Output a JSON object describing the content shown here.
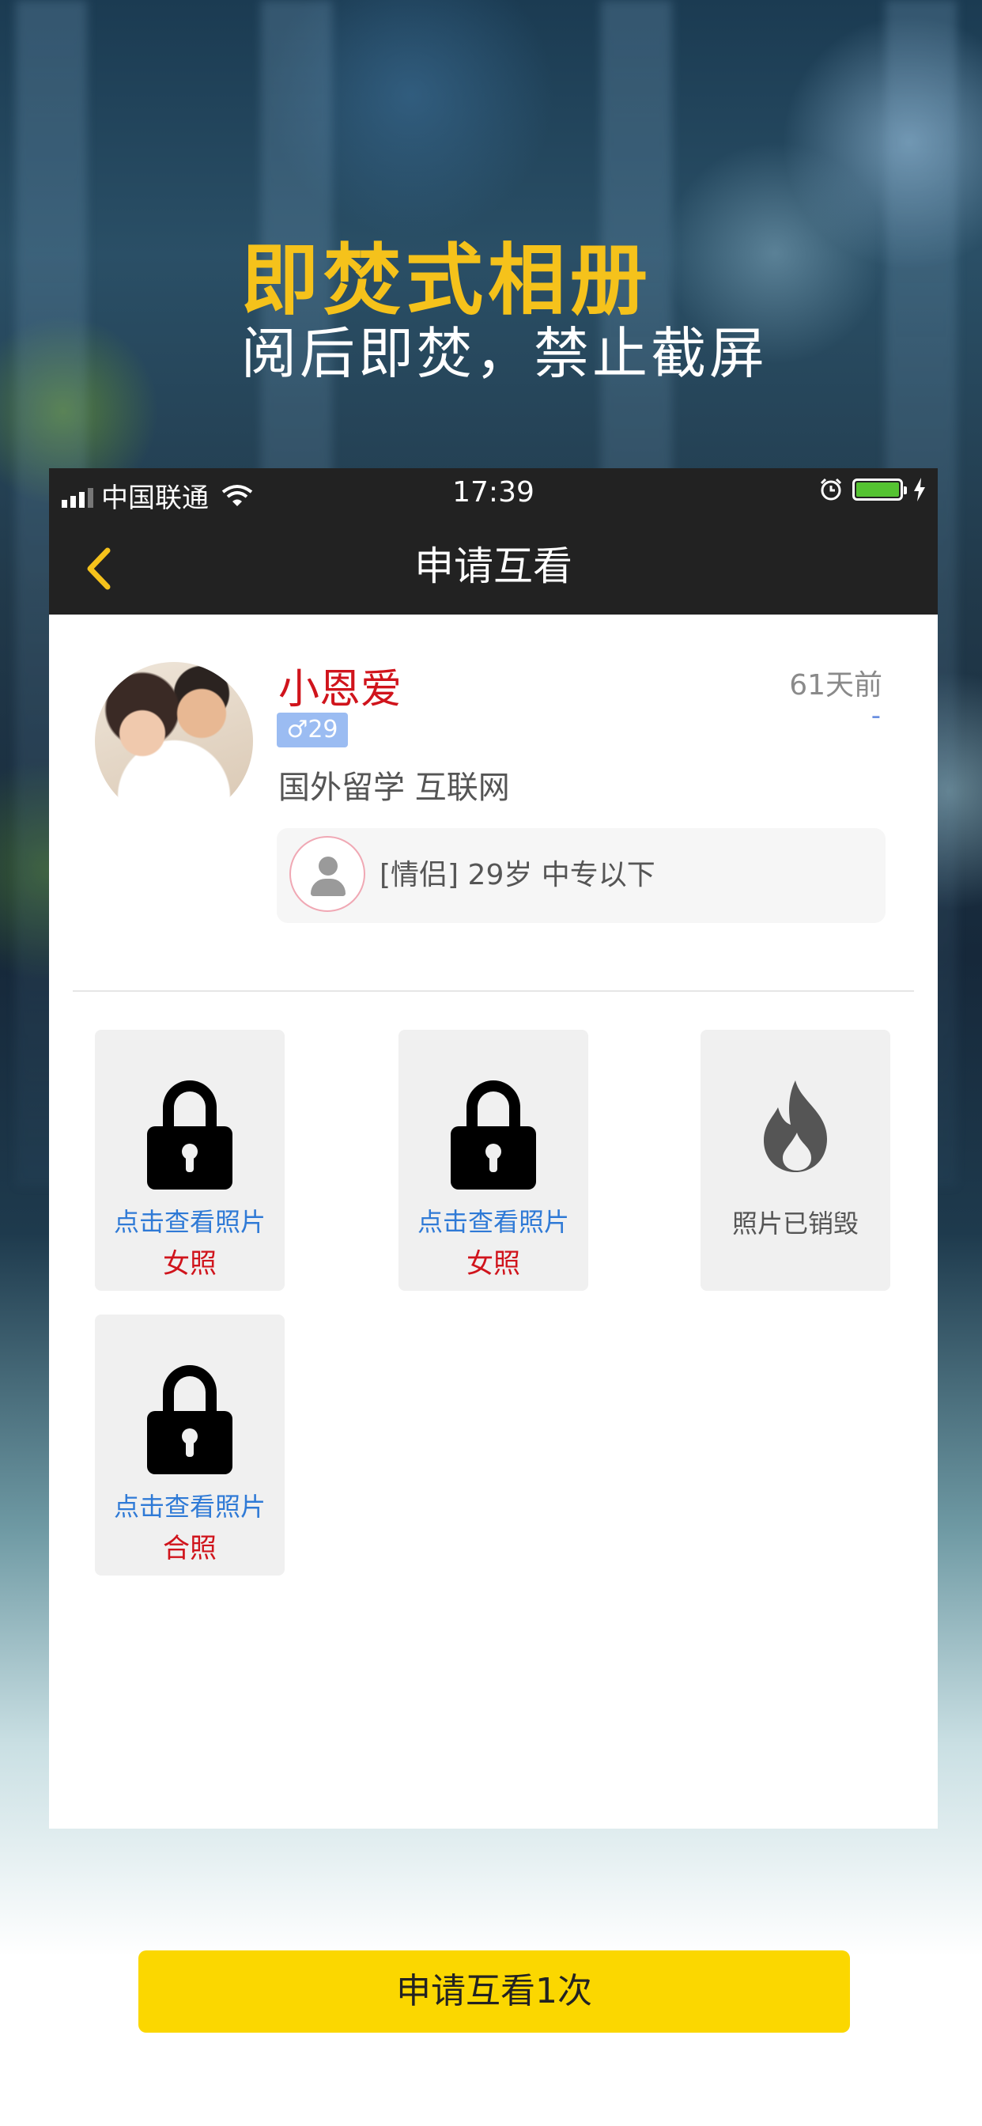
{
  "promo": {
    "title": "即焚式相册",
    "subtitle": "阅后即焚，禁止截屏"
  },
  "status_bar": {
    "carrier": "中国联通",
    "time": "17:39",
    "icons": [
      "signal-icon",
      "wifi-icon",
      "alarm-icon",
      "battery-icon",
      "charging-icon"
    ],
    "battery_color": "#55c332"
  },
  "navbar": {
    "title": "申请互看",
    "back_icon": "chevron-left-icon",
    "accent": "#f5c21b"
  },
  "profile": {
    "name": "小恩爱",
    "time_ago": "61天前",
    "dash": "-",
    "gender_age": "♂29",
    "tags": "国外留学 互联网",
    "partner_info": "[情侣] 29岁 中专以下"
  },
  "photos": [
    {
      "type": "locked",
      "action": "点击查看照片",
      "label": "女照"
    },
    {
      "type": "locked",
      "action": "点击查看照片",
      "label": "女照"
    },
    {
      "type": "destroyed",
      "status": "照片已销毁"
    },
    {
      "type": "locked",
      "action": "点击查看照片",
      "label": "合照"
    }
  ],
  "apply_button": {
    "label": "申请互看1次",
    "color": "#fbd700"
  }
}
